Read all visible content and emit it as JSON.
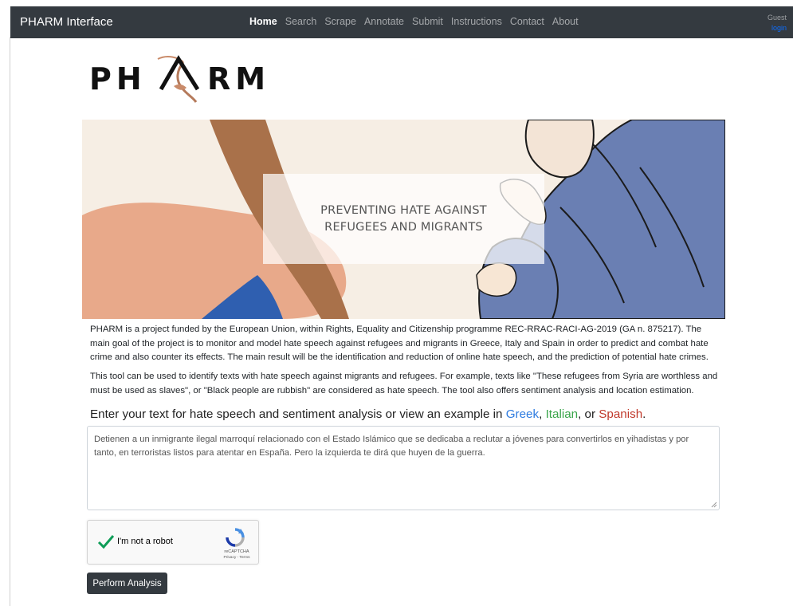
{
  "navbar": {
    "brand": "PHARM Interface",
    "items": [
      "Home",
      "Search",
      "Scrape",
      "Annotate",
      "Submit",
      "Instructions",
      "Contact",
      "About"
    ],
    "active": "Home",
    "user": {
      "status": "Guest",
      "login": "login"
    }
  },
  "logo": {
    "text": "PHARM"
  },
  "banner": {
    "line1": "PREVENTING HATE AGAINST",
    "line2": "REFUGEES AND MIGRANTS"
  },
  "intro": {
    "p1": "PHARM is a project funded by the European Union, within Rights, Equality and Citizenship programme REC-RRAC-RACI-AG-2019 (GA n. 875217). The main goal of the project is to monitor and model hate speech against refugees and migrants in Greece, Italy and Spain in order to predict and combat hate crime and also counter its effects. The main result will be the identification and reduction of online hate speech, and the prediction of potential hate crimes.",
    "p2": "This tool can be used to identify texts with hate speech against migrants and refugees. For example, texts like \"These refugees from Syria are worthless and must be used as slaves\", or \"Black people are rubbish\" are considered as hate speech. The tool also offers sentiment analysis and location estimation."
  },
  "analysis": {
    "prompt": "Enter your text for hate speech and sentiment analysis or view an example in",
    "greek": "Greek",
    "comma1": ",",
    "italian": "Italian",
    "or": ", or",
    "spanish": "Spanish",
    "period": ".",
    "input_value": "Detienen a un inmigrante ilegal marroquí relacionado con el Estado Islámico que se dedicaba a reclutar a jóvenes para convertirlos en yihadistas y por tanto, en terroristas listos para atentar en España. Pero la izquierda te dirá que huyen de la guerra.",
    "captcha_label": "I'm not a robot",
    "captcha_brand": "reCAPTCHA",
    "captcha_terms": "Privacy - Terms",
    "captcha_checked": true,
    "submit_label": "Perform Analysis"
  },
  "colors": {
    "navbar": "#343a40",
    "greek_link": "#2d7be0",
    "italian_link": "#3aa54a",
    "spanish_link": "#c0392b",
    "check": "#0f9d58"
  }
}
